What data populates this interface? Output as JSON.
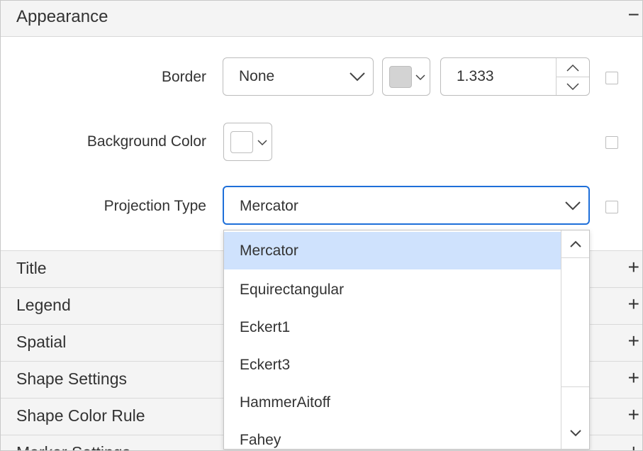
{
  "appearance": {
    "title": "Appearance",
    "toggle": "−",
    "border": {
      "label": "Border",
      "style_value": "None",
      "width_value": "1.333",
      "color_swatch": "#d3d3d3"
    },
    "background": {
      "label": "Background Color",
      "color_swatch": "#ffffff"
    },
    "projection": {
      "label": "Projection Type",
      "value": "Mercator",
      "options": [
        "Mercator",
        "Equirectangular",
        "Eckert1",
        "Eckert3",
        "HammerAitoff",
        "Fahey"
      ],
      "selected_index": 0
    }
  },
  "sections": [
    {
      "title": "Title",
      "toggle": "+"
    },
    {
      "title": "Legend",
      "toggle": "+"
    },
    {
      "title": "Spatial",
      "toggle": "+"
    },
    {
      "title": "Shape Settings",
      "toggle": "+"
    },
    {
      "title": "Shape Color Rule",
      "toggle": "+"
    },
    {
      "title": "Marker Settings",
      "toggle": "+"
    }
  ],
  "colors": {
    "accent": "#1e6fd9",
    "selected_bg": "#cfe2fd",
    "header_bg": "#f4f4f4"
  }
}
